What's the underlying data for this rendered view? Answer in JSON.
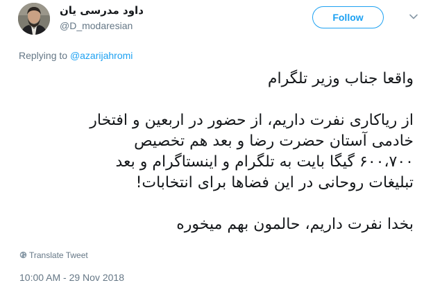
{
  "author": {
    "display_name": "داود مدرسی یان",
    "handle": "@D_modaresian",
    "avatar": "avatar-photo"
  },
  "header": {
    "follow_label": "Follow",
    "menu_icon": "chevron-down-icon"
  },
  "reply": {
    "prefix": "Replying to ",
    "target": "@azarijahromi"
  },
  "tweet": {
    "lines": [
      "واقعا جناب وزیر تلگرام",
      "",
      "از ریاکاری نفرت داریم، از حضور در اربعین و افتخار",
      "خادمی آستان حضرت رضا و بعد هم تخصیص",
      "۶۰۰،۷۰۰ گیگا بایت به تلگرام و اینستاگرام و بعد",
      "تبلیغات روحانی در این فضاها برای انتخابات!",
      "",
      "بخدا نفرت داریم، حالمون بهم میخوره"
    ]
  },
  "translate": {
    "label": "Translate Tweet",
    "icon": "globe-icon"
  },
  "timestamp": "10:00 AM - 29 Nov 2018",
  "colors": {
    "accent": "#1da1f2",
    "secondary_text": "#657786",
    "primary_text": "#14171a"
  }
}
